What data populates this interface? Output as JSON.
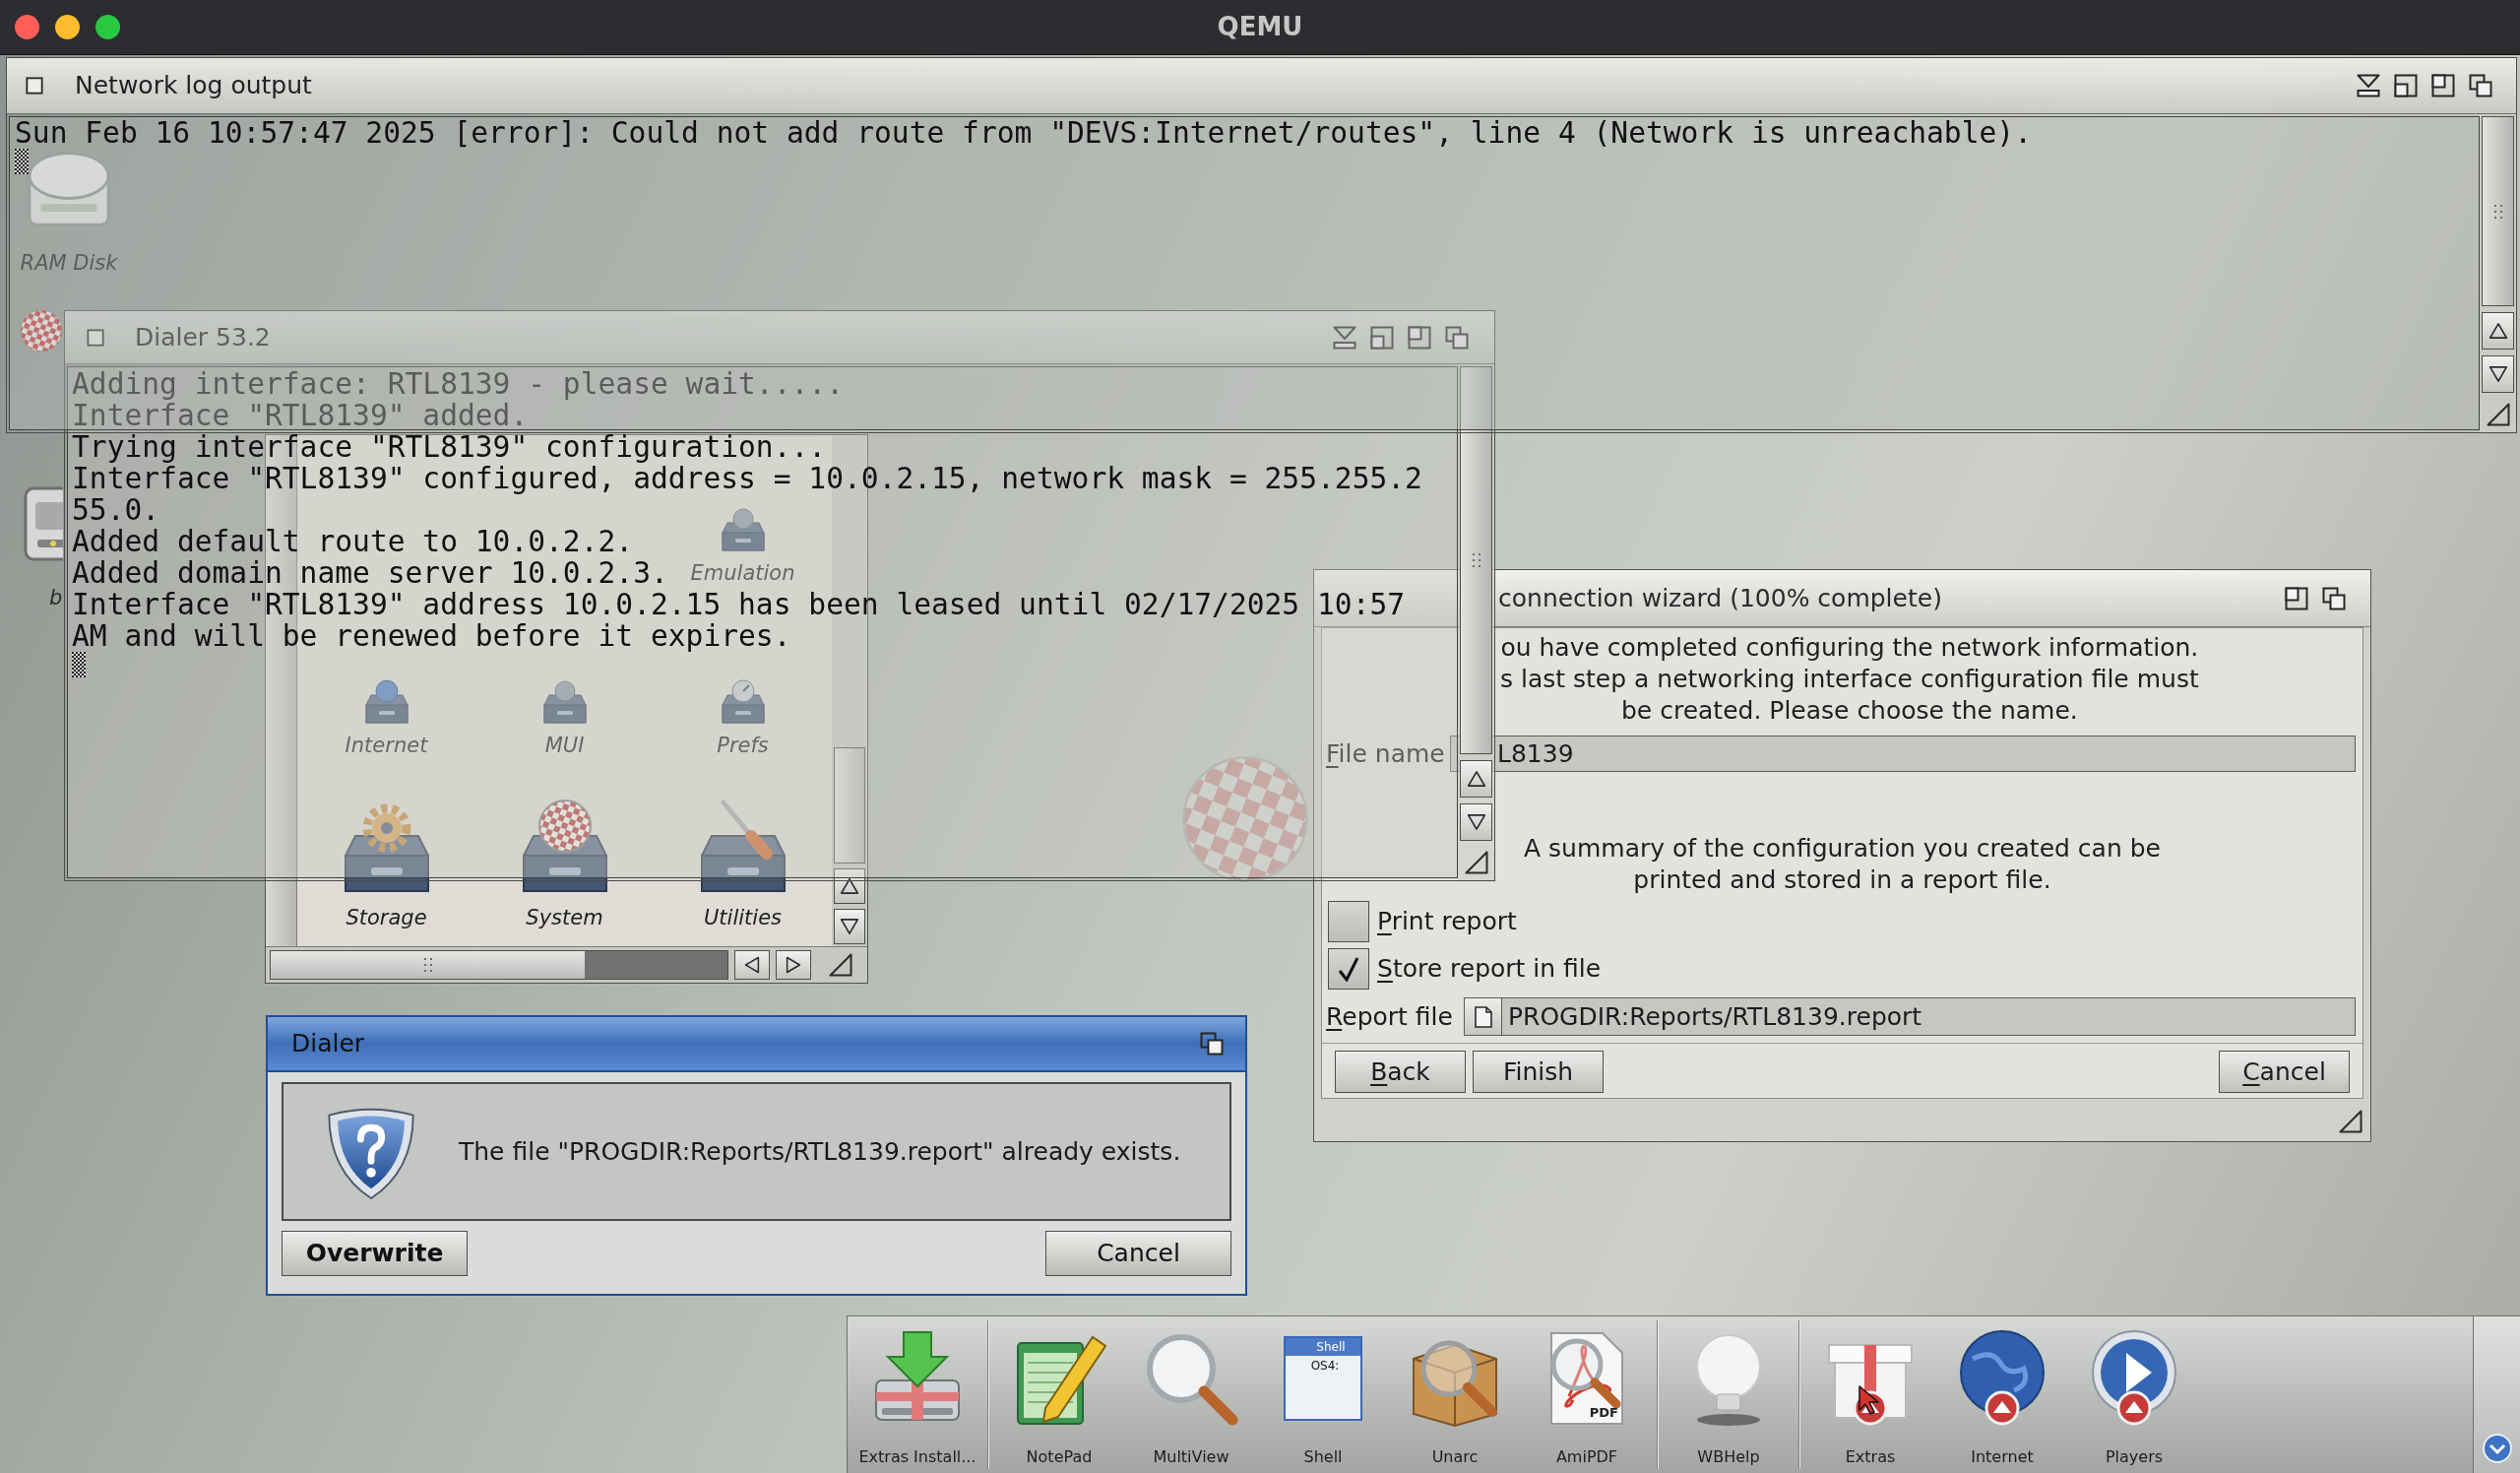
{
  "host_window": {
    "title": "QEMU"
  },
  "desktop_icons": [
    {
      "label": "RAM Disk"
    },
    {
      "label": "b"
    }
  ],
  "network_log": {
    "title": "Network log output",
    "lines": [
      "Sun Feb 16 10:57:47 2025 [error]: Could not add route from \"DEVS:Internet/routes\", line 4 (Network is unreachable)."
    ]
  },
  "drawer_window": {
    "icons": [
      {
        "label": "Emulation"
      },
      {
        "label": "Internet"
      },
      {
        "label": "MUI"
      },
      {
        "label": "Prefs"
      },
      {
        "label": "Storage"
      },
      {
        "label": "System"
      },
      {
        "label": "Utilities"
      }
    ]
  },
  "wizard": {
    "title": "connection wizard (100% complete)",
    "intro": [
      "ou have completed configuring the network information.",
      "s last step a networking interface configuration file must",
      "be created. Please choose the name."
    ],
    "file_name": {
      "label": "File name",
      "key_underlined": true,
      "value": "L8139"
    },
    "summary": [
      "A summary of the configuration you created can be",
      "printed and stored in a report file."
    ],
    "options": [
      {
        "label": "Print report",
        "key_underlined": true,
        "checked": false
      },
      {
        "label": "Store report in file",
        "key_underlined": true,
        "checked": true
      }
    ],
    "report_file": {
      "label": "Report file",
      "key_underlined": true,
      "value": "PROGDIR:Reports/RTL8139.report"
    },
    "buttons": [
      {
        "label": "Back",
        "key_underlined": true
      },
      {
        "label": "Finish",
        "key_underlined": false
      },
      {
        "label": "Cancel",
        "key_underlined": true
      }
    ]
  },
  "dialer_log": {
    "title": "Dialer 53.2",
    "lines": [
      "Adding interface: RTL8139 - please wait.....",
      "Interface \"RTL8139\" added.",
      "Trying interface \"RTL8139\" configuration...",
      "Interface \"RTL8139\" configured, address = 10.0.2.15, network mask = 255.255.2",
      "55.0.",
      "Added default route to 10.0.2.2.",
      "Added domain name server 10.0.2.3.",
      "Interface \"RTL8139\" address 10.0.2.15 has been leased until 02/17/2025 10:57",
      "AM and will be renewed before it expires."
    ]
  },
  "requester": {
    "title": "Dialer",
    "message": "The file \"PROGDIR:Reports/RTL8139.report\" already exists.",
    "buttons": [
      {
        "label": "Overwrite",
        "default": true
      },
      {
        "label": "Cancel",
        "default": false
      }
    ]
  },
  "dock": {
    "groups": [
      [
        {
          "label": "Extras Install..."
        }
      ],
      [
        {
          "label": "NotePad"
        },
        {
          "label": "MultiView"
        },
        {
          "label": "Shell",
          "icon_title": "Shell",
          "icon_prompt": "OS4:"
        },
        {
          "label": "Unarc"
        },
        {
          "label": "AmiPDF",
          "icon_badge": "PDF"
        }
      ],
      [
        {
          "label": "WBHelp"
        }
      ],
      [
        {
          "label": "Extras"
        },
        {
          "label": "Internet"
        },
        {
          "label": "Players"
        }
      ]
    ]
  }
}
